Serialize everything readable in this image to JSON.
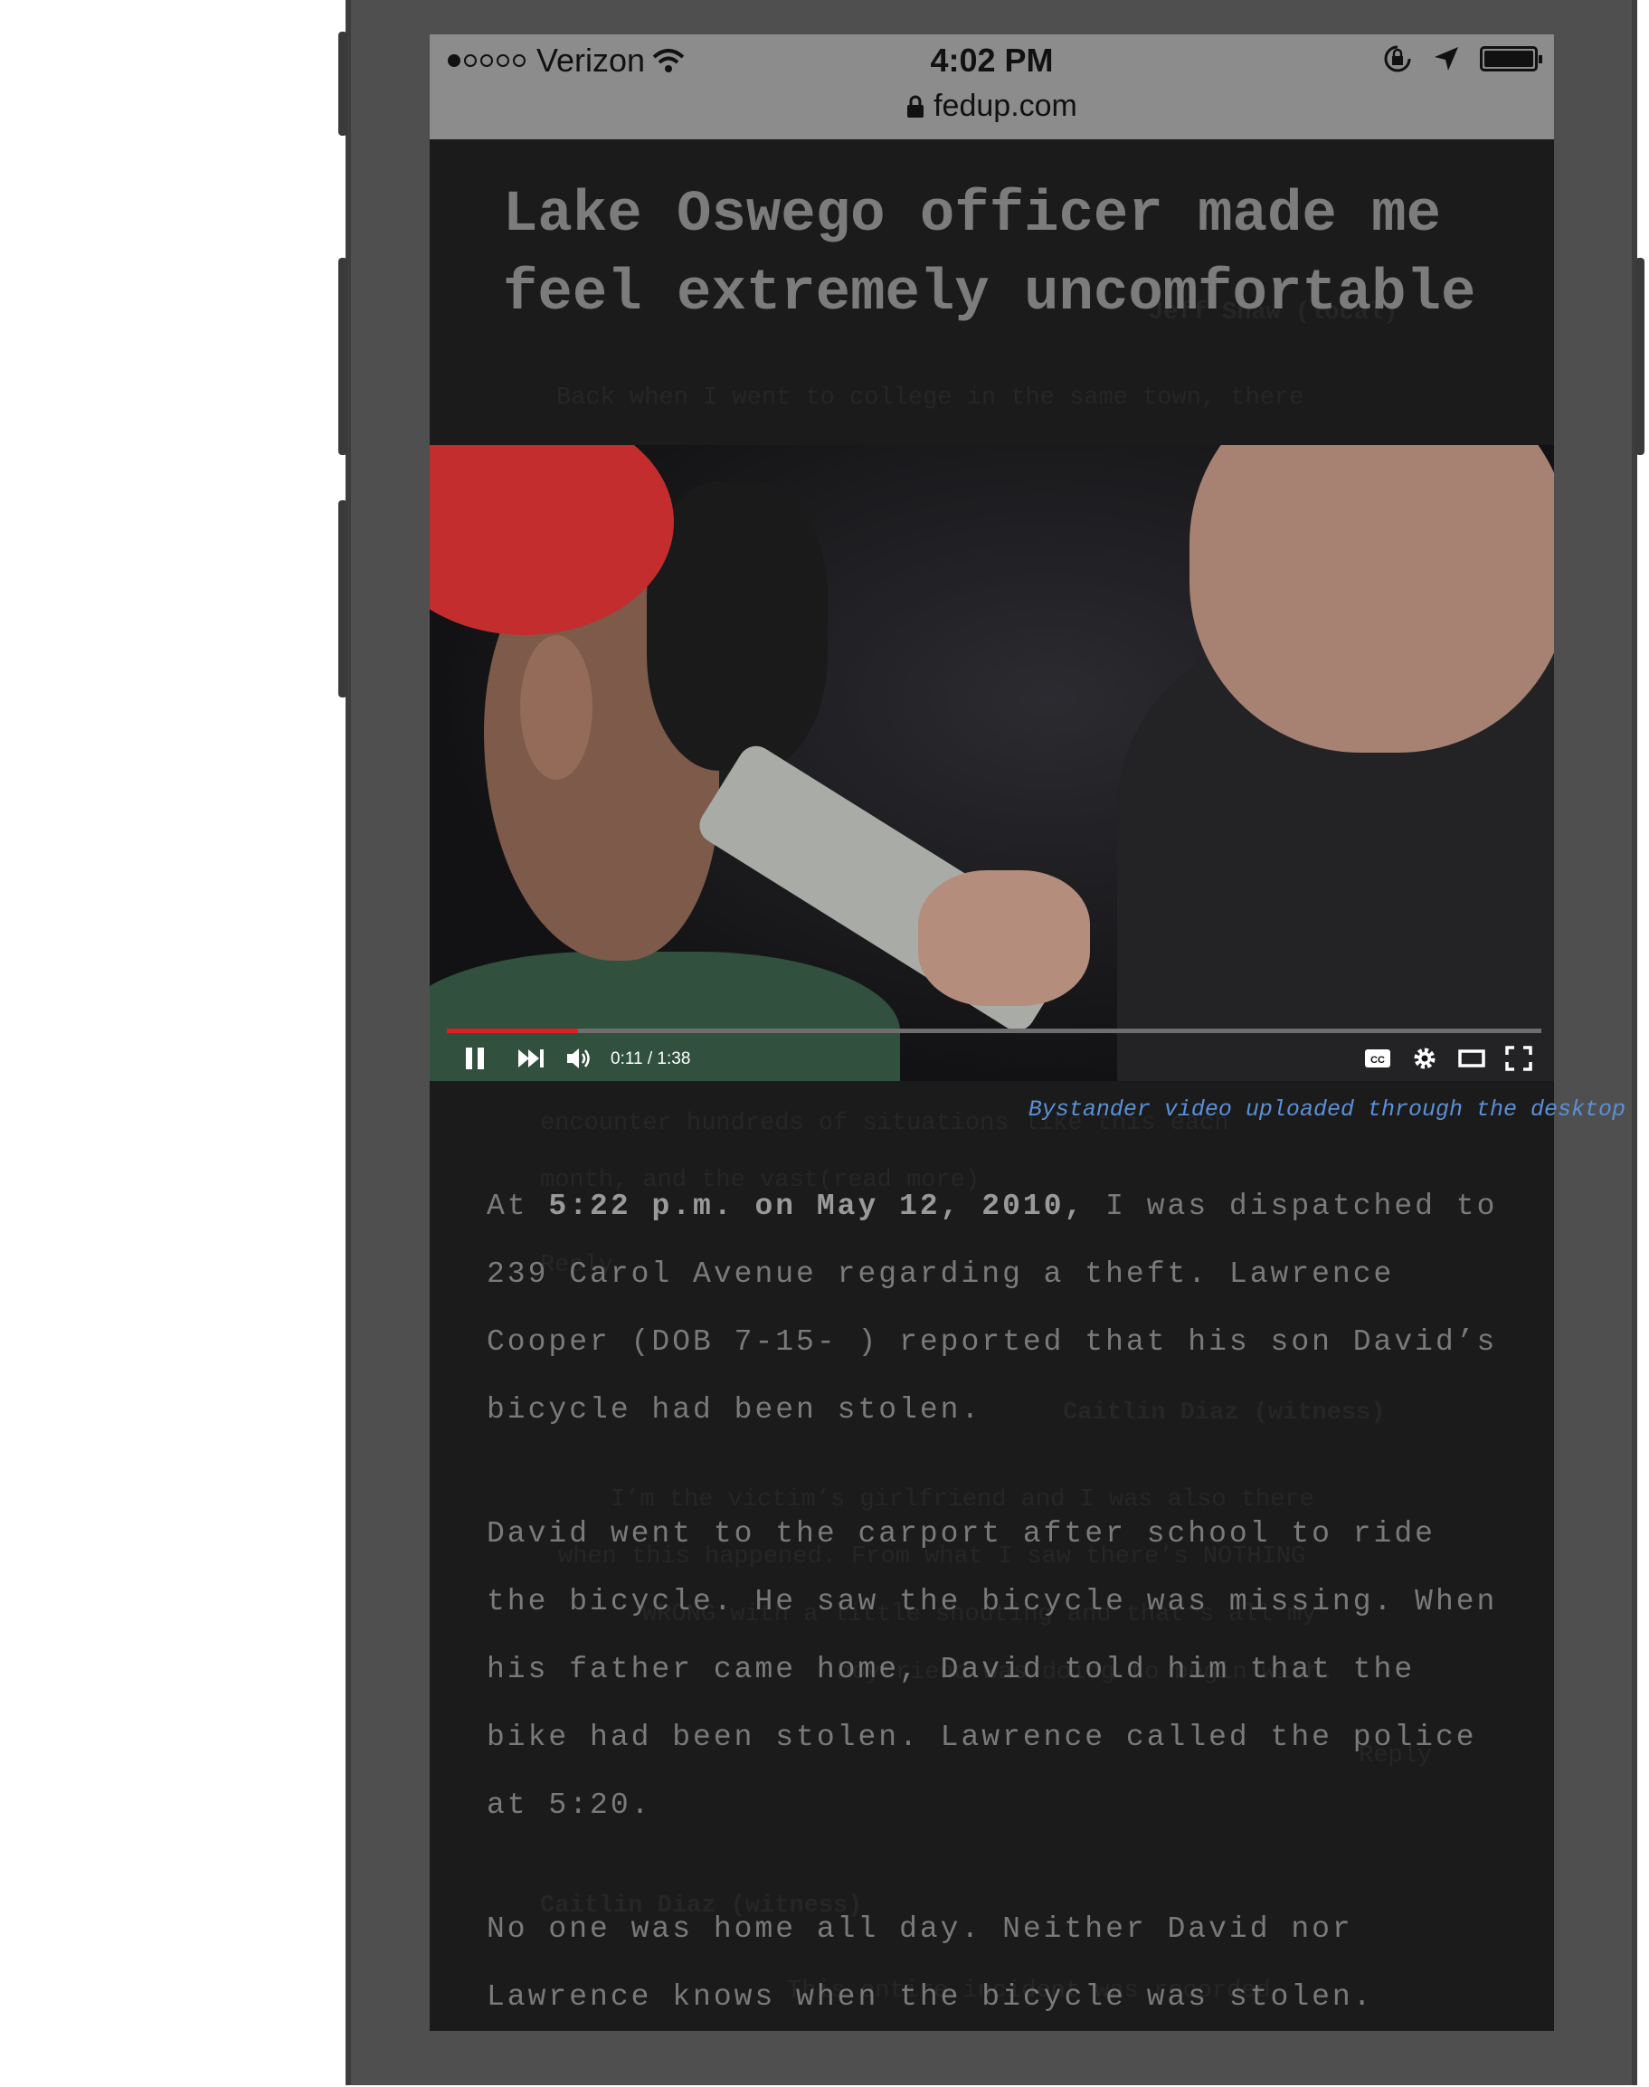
{
  "status_bar": {
    "carrier": "Verizon",
    "time": "4:02 PM",
    "url": "fedup.com",
    "signal_bars_filled": 1,
    "signal_bars_total": 5
  },
  "article": {
    "title": "Lake Oswego officer made me feel extremely uncomfortable",
    "video": {
      "time_display": "0:11 / 1:38",
      "progress_fraction": 0.12,
      "caption": "Bystander video uploaded through the desktop"
    },
    "paragraphs": [
      {
        "pre": "At ",
        "bold": "5:22 p.m. on May 12, 2010,",
        "post": " I was dispatched to 239 Carol Avenue regarding a theft. Lawrence Cooper (DOB 7-15- ) reported that his son David’s bicycle had been stolen."
      },
      {
        "pre": "David went to the carport after school to ride the bicycle. He saw the bicycle was missing. When his father came home, David told him that the bike had been stolen. Lawrence called the police at 5:20.",
        "bold": "",
        "post": ""
      },
      {
        "pre": "No one was home all day. Neither David nor Lawrence knows when the bicycle was stolen.",
        "bold": "",
        "post": ""
      }
    ]
  },
  "background_comments": {
    "c1_author": "Jeff Shaw (local)",
    "c1_line1": "Back when I went to college in the same town, there",
    "c1_line2": "encounter hundreds of situations like this each",
    "c1_line3": "month, and the vast(read more)",
    "c1_line4": "Reply",
    "c2_author": "Caitlin Diaz (witness)",
    "c2_line1": "I’m the victim’s girlfriend and I was also there",
    "c2_line2": "when this happened. From what I saw there’s NOTHING",
    "c2_line3": "WRONG with a little shouting and that’s all my",
    "c2_line4": "boyfriend was doing to begin with.",
    "c2_line5": "Reply",
    "c3_author": "Caitlin Diaz (witness)",
    "c3_line1": "This entire incident was recorded"
  },
  "colors": {
    "page_bg": "#1b1b1b",
    "title": "#7c7c7c",
    "body_text": "#7a7a7a",
    "caption": "#5b8fd6",
    "progress": "#e02020",
    "status_bar": "#8c8c8c"
  },
  "icons": [
    "signal-dots-icon",
    "wifi-icon",
    "lock-icon",
    "rotation-lock-icon",
    "location-arrow-icon",
    "battery-icon",
    "pause-icon",
    "next-icon",
    "volume-icon",
    "cc-icon",
    "settings-icon",
    "theater-mode-icon",
    "fullscreen-icon"
  ]
}
